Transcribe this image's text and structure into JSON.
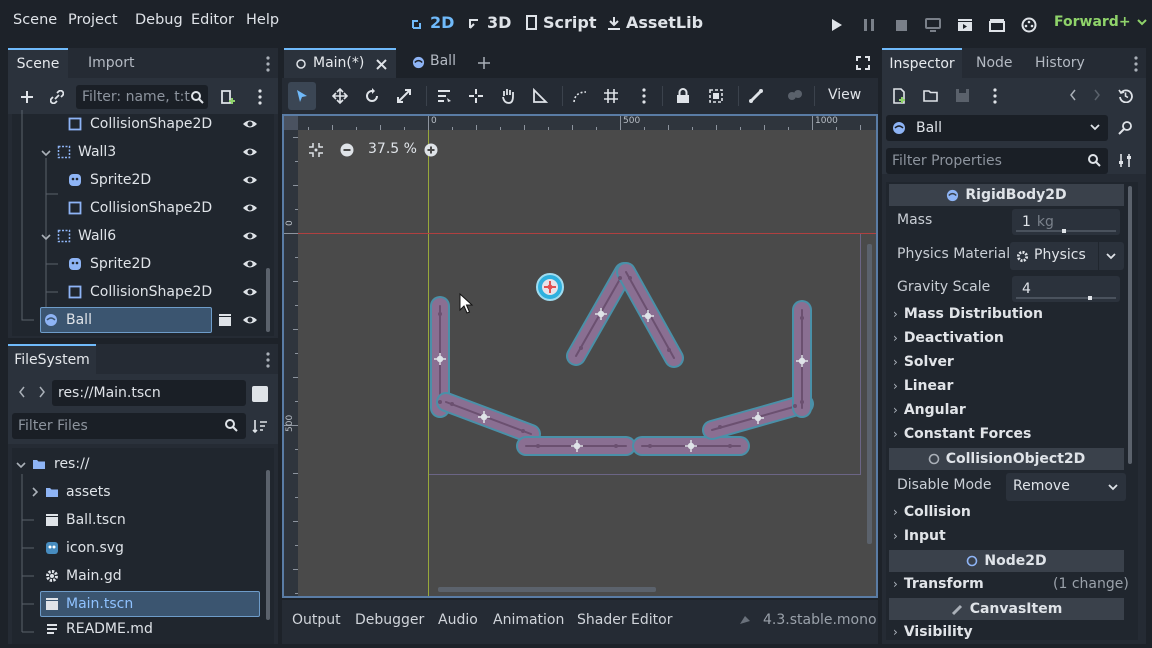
{
  "menu": [
    "Scene",
    "Project",
    "Debug",
    "Editor",
    "Help"
  ],
  "modes": {
    "m2d": "2D",
    "m3d": "3D",
    "script": "Script",
    "assetlib": "AssetLib"
  },
  "renderer": "Forward+",
  "scene_dock": {
    "tabs": [
      "Scene",
      "Import"
    ],
    "filter_placeholder": "Filter: name, t:t",
    "tree": [
      {
        "label": "CollisionShape2D",
        "type": "collision"
      },
      {
        "label": "Wall3",
        "type": "node2d"
      },
      {
        "label": "Sprite2D",
        "type": "sprite"
      },
      {
        "label": "CollisionShape2D",
        "type": "collision"
      },
      {
        "label": "Wall6",
        "type": "node2d"
      },
      {
        "label": "Sprite2D",
        "type": "sprite"
      },
      {
        "label": "CollisionShape2D",
        "type": "collision"
      },
      {
        "label": "Ball",
        "type": "rigid"
      }
    ]
  },
  "filesystem": {
    "tab": "FileSystem",
    "path": "res://Main.tscn",
    "filter_placeholder": "Filter Files",
    "items": [
      "res://",
      "assets",
      "Ball.tscn",
      "icon.svg",
      "Main.gd",
      "Main.tscn",
      "README.md"
    ]
  },
  "editor_tabs": [
    "Main(*)",
    "Ball"
  ],
  "toolbar": {
    "view": "View"
  },
  "zoom": "37.5 %",
  "rulers": {
    "h": [
      "0",
      "500",
      "1000"
    ],
    "v": [
      "0",
      "500"
    ]
  },
  "inspector": {
    "tabs": [
      "Inspector",
      "Node",
      "History"
    ],
    "object": "Ball",
    "filter_placeholder": "Filter Properties",
    "rigidbody_header": "RigidBody2D",
    "mass_label": "Mass",
    "mass_value": "1",
    "mass_unit": "kg",
    "physics_material_label": "Physics Material",
    "physics_material_value": "Physics",
    "gravity_label": "Gravity Scale",
    "gravity_value": "4",
    "groups1": [
      "Mass Distribution",
      "Deactivation",
      "Solver",
      "Linear",
      "Angular",
      "Constant Forces"
    ],
    "collision_header": "CollisionObject2D",
    "disable_mode_label": "Disable Mode",
    "disable_mode_value": "Remove",
    "groups2": [
      "Collision",
      "Input"
    ],
    "node2d_header": "Node2D",
    "transform_label": "Transform",
    "transform_note": "(1 change)",
    "canvas_header": "CanvasItem",
    "visibility_label": "Visibility"
  },
  "bottom_tabs": [
    "Output",
    "Debugger",
    "Audio",
    "Animation",
    "Shader Editor"
  ],
  "version": "4.3.stable.mono",
  "colors": {
    "accent": "#70bafa",
    "renderer": "#8fd36a",
    "wall": "#8a6f92"
  }
}
